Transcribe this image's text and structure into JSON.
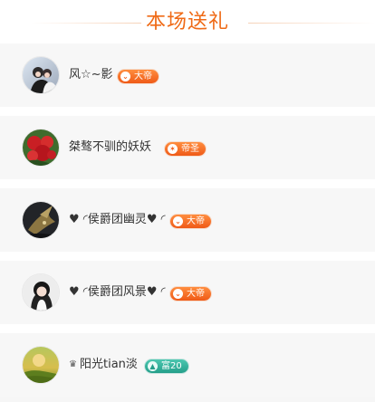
{
  "header": {
    "title": "本场送礼"
  },
  "colors": {
    "accent": "#ef6a16",
    "text": "#333333",
    "row_bg": "#f7f7f7",
    "gap_bg": "#ffffff",
    "badge_orange": "#ef5a17",
    "badge_teal": "#249f8a"
  },
  "gifters": [
    {
      "name": "风☆~影",
      "badge_label": "大帝",
      "badge_icon": "emperor-icon",
      "avatar_desc": "couple"
    },
    {
      "name": "桀骜不驯的妖妖",
      "badge_label": "帝圣",
      "badge_icon": "saint-icon",
      "avatar_desc": "red roses"
    },
    {
      "name": "♥ ◜侯爵团幽灵♥ ◜",
      "badge_label": "大帝",
      "badge_icon": "emperor-icon",
      "avatar_desc": "dark creature"
    },
    {
      "name": "♥ ◜侯爵团风景♥ ◜",
      "badge_label": "大帝",
      "badge_icon": "emperor-icon",
      "avatar_desc": "woman portrait"
    },
    {
      "prefix_icon": "crown-icon",
      "name": "阳光tian淡",
      "badge_label": "富20",
      "badge_icon": "rich-icon",
      "avatar_desc": "sunset field"
    }
  ]
}
